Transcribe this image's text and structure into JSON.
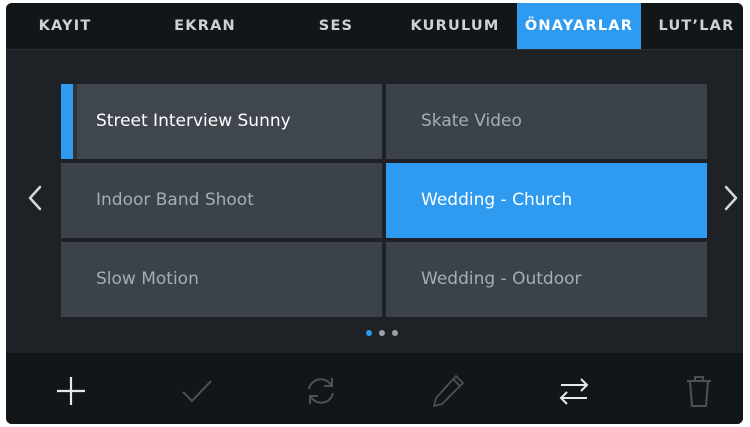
{
  "tabs": [
    {
      "label": "KAYIT",
      "active": false
    },
    {
      "label": "EKRAN",
      "active": false
    },
    {
      "label": "SES",
      "active": false
    },
    {
      "label": "KURULUM",
      "active": false
    },
    {
      "label": "ÖNAYARLAR",
      "active": true
    },
    {
      "label": "LUT’LAR",
      "active": false
    }
  ],
  "presets": [
    {
      "label": "Street Interview Sunny",
      "state": "focused"
    },
    {
      "label": "Skate Video",
      "state": "normal"
    },
    {
      "label": "Indoor Band Shoot",
      "state": "normal"
    },
    {
      "label": "Wedding  - Church",
      "state": "selected"
    },
    {
      "label": "Slow Motion",
      "state": "normal"
    },
    {
      "label": "Wedding - Outdoor",
      "state": "normal"
    }
  ],
  "pagination": {
    "pages": 3,
    "current": 1
  },
  "toolbar": {
    "icons": [
      "plus-icon",
      "check-icon",
      "refresh-icon",
      "pencil-icon",
      "swap-arrows-icon",
      "trash-icon"
    ]
  },
  "colors": {
    "accent": "#2e9bf0",
    "background": "#1e2227",
    "bar_background": "#131619",
    "cell_background": "#3b424a"
  }
}
